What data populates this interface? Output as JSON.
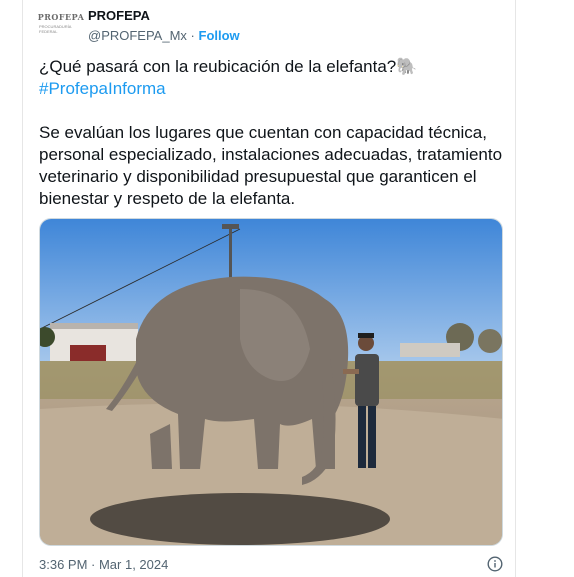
{
  "account": {
    "name": "PROFEPA",
    "handle": "@PROFEPA_Mx",
    "separator": "·",
    "follow_label": "Follow",
    "avatar": {
      "logo_text": "PROFEPA",
      "logo_subtext": "PROCURADURÍA FEDERAL"
    }
  },
  "tweet": {
    "line1": "¿Qué pasará con la reubicación de la elefanta?",
    "emoji": "🐘",
    "hashtag": "#ProfepaInforma",
    "paragraph": "Se evalúan los lugares que cuentan con capacidad técnica, personal especializado, instalaciones adecuadas, tratamiento veterinario y disponibilidad presupuestal que garanticen el bienestar y respeto de la elefanta.",
    "timestamp": "3:36 PM · Mar 1, 2024"
  },
  "media": {
    "icon": "photo-elephant-with-keeper"
  },
  "colors": {
    "link": "#1d9bf0",
    "text": "#0f1419",
    "muted": "#536471",
    "border": "#cfd9de"
  }
}
